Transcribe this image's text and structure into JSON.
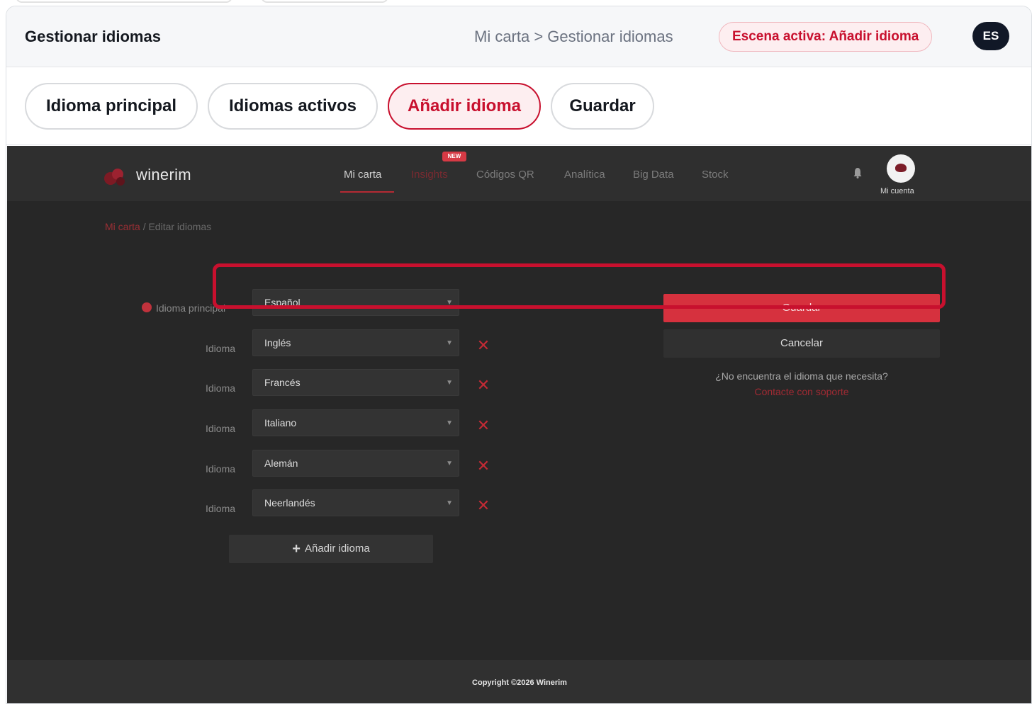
{
  "header": {
    "title": "Gestionar idiomas",
    "breadcrumb": "Mi carta > Gestionar idiomas",
    "scene_badge": "Escena activa: Añadir idioma",
    "language": "ES"
  },
  "chips": [
    {
      "label": "Idioma principal",
      "active": false
    },
    {
      "label": "Idiomas activos",
      "active": false
    },
    {
      "label": "Añadir idioma",
      "active": true
    },
    {
      "label": "Guardar",
      "active": false
    }
  ],
  "app": {
    "logo": "winerim",
    "nav": [
      "Mi carta",
      "Insights",
      "Códigos QR",
      "Analítica",
      "Big Data",
      "Stock"
    ],
    "new_badge": "NEW",
    "account_label": "Mi cuenta",
    "breadcrumb_link": "Mi carta",
    "breadcrumb_sep": "/",
    "breadcrumb_current": "Editar idiomas",
    "main_label": "Idioma principal",
    "main_value": "Español",
    "row_label": "Idioma",
    "languages": [
      "Inglés",
      "Francés",
      "Italiano",
      "Alemán",
      "Neerlandés"
    ],
    "add_button": "Añadir idioma",
    "save_button": "Guardar",
    "cancel_button": "Cancelar",
    "help_text": "¿No encuentra el idioma que necesita?",
    "help_link": "Contacte con soporte",
    "copyright": "Copyright ©2026 Winerim"
  },
  "colors": {
    "accent": "#c8102e",
    "app_bg": "#272727",
    "save_bg": "#d6313e"
  }
}
